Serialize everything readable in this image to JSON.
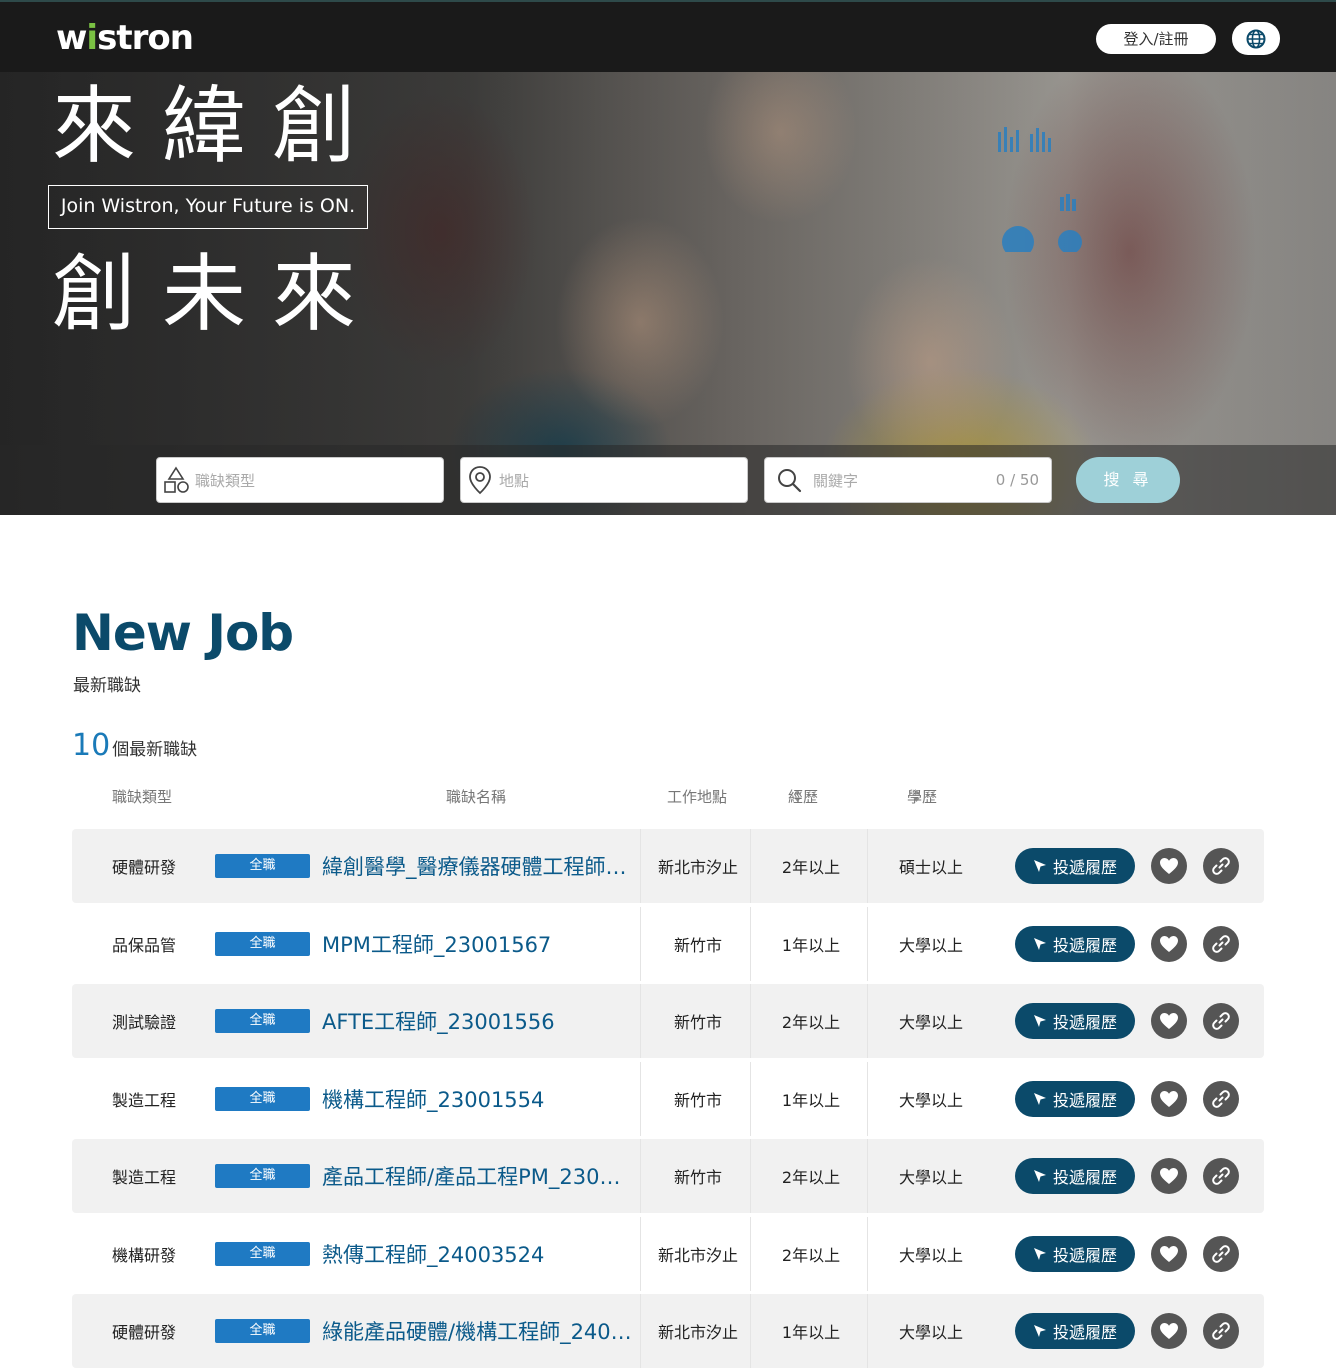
{
  "header": {
    "logo_text": "wistron",
    "login_label": "登入/註冊",
    "lang_icon": "globe-icon"
  },
  "hero": {
    "line1": "來緯創",
    "slogan": "Join Wistron, Your Future is ON.",
    "line2": "創未來"
  },
  "search": {
    "category_placeholder": "職缺類型",
    "location_placeholder": "地點",
    "keyword_placeholder": "關鍵字",
    "keyword_count": "0 / 50",
    "button_label": "搜 尋"
  },
  "section": {
    "title": "New Job",
    "subtitle": "最新職缺",
    "count": "10",
    "count_label": "個最新職缺"
  },
  "table": {
    "headers": {
      "type": "職缺類型",
      "name": "職缺名稱",
      "location": "工作地點",
      "experience": "經歷",
      "education": "學歷"
    },
    "apply_label": "投遞履歷",
    "rows": [
      {
        "type": "硬體研發",
        "badge": "全職",
        "title": "緯創醫學_醫療儀器硬體工程師_2...",
        "location": "新北市汐止",
        "experience": "2年以上",
        "education": "碩士以上"
      },
      {
        "type": "品保品管",
        "badge": "全職",
        "title": "MPM工程師_23001567",
        "location": "新竹市",
        "experience": "1年以上",
        "education": "大學以上"
      },
      {
        "type": "測試驗證",
        "badge": "全職",
        "title": "AFTE工程師_23001556",
        "location": "新竹市",
        "experience": "2年以上",
        "education": "大學以上"
      },
      {
        "type": "製造工程",
        "badge": "全職",
        "title": "機構工程師_23001554",
        "location": "新竹市",
        "experience": "1年以上",
        "education": "大學以上"
      },
      {
        "type": "製造工程",
        "badge": "全職",
        "title": "產品工程師/產品工程PM_23001...",
        "location": "新竹市",
        "experience": "2年以上",
        "education": "大學以上"
      },
      {
        "type": "機構研發",
        "badge": "全職",
        "title": "熱傳工程師_24003524",
        "location": "新北市汐止",
        "experience": "2年以上",
        "education": "大學以上"
      },
      {
        "type": "硬體研發",
        "badge": "全職",
        "title": "綠能產品硬體/機構工程師_24001",
        "location": "新北市汐止",
        "experience": "1年以上",
        "education": "大學以上"
      }
    ]
  }
}
